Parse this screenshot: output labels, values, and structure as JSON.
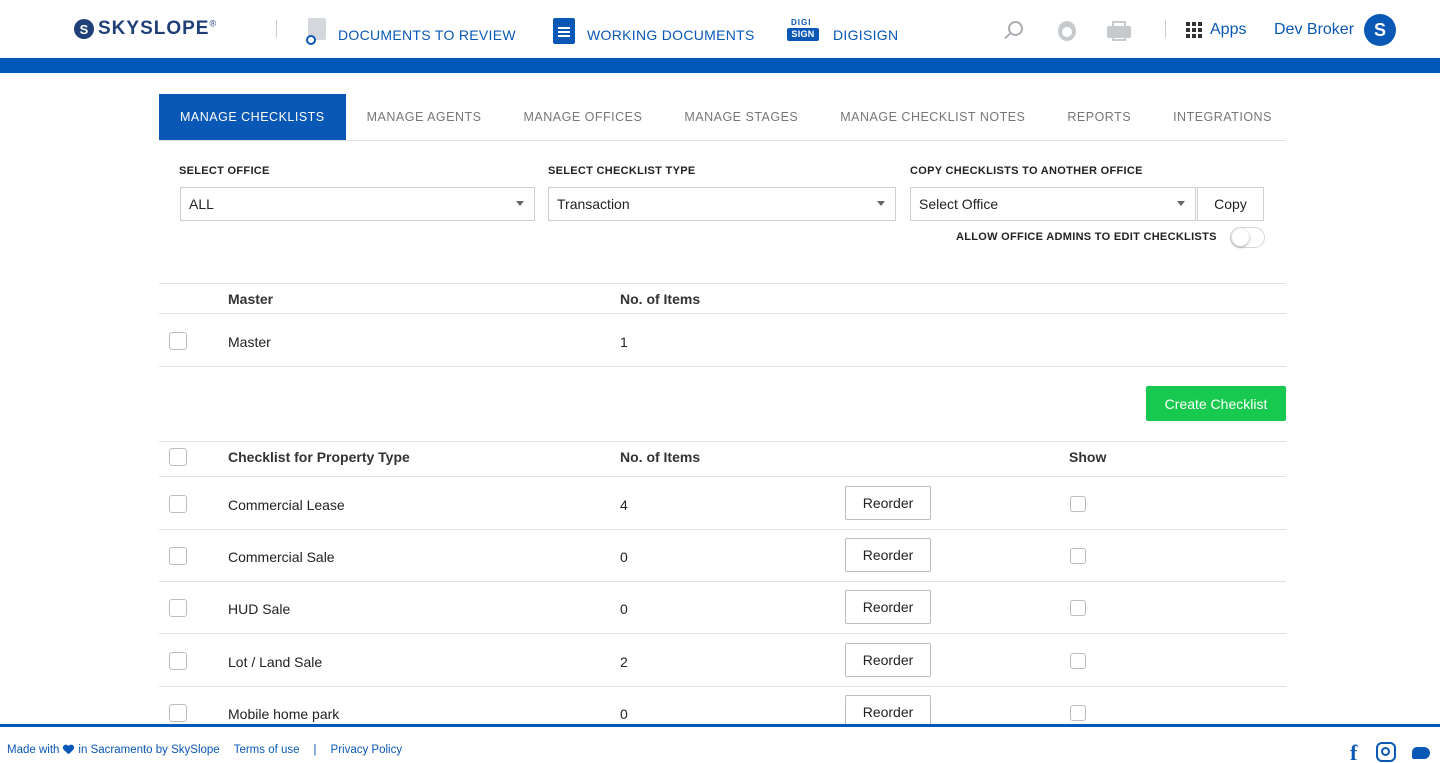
{
  "header": {
    "logo_text": "SKYSLOPE",
    "logo_mark": "S",
    "logo_reg": "®",
    "nav": [
      {
        "label": "DOCUMENTS TO REVIEW",
        "icon": "documents-review-icon"
      },
      {
        "label": "WORKING DOCUMENTS",
        "icon": "working-documents-icon"
      },
      {
        "label": "DIGISIGN",
        "icon": "digisign-icon",
        "badge_top": "DIGI",
        "badge_bottom": "SIGN"
      }
    ],
    "icons": [
      "search-icon",
      "agent-icon",
      "printer-icon"
    ],
    "apps_label": "Apps",
    "user_name": "Dev Broker",
    "avatar_letter": "S"
  },
  "colors": {
    "brand_blue": "#0057b8",
    "link_blue": "#0a58b5",
    "green": "#17c94f"
  },
  "tabs": [
    {
      "label": "MANAGE CHECKLISTS",
      "active": true
    },
    {
      "label": "MANAGE AGENTS",
      "active": false
    },
    {
      "label": "MANAGE OFFICES",
      "active": false
    },
    {
      "label": "MANAGE STAGES",
      "active": false
    },
    {
      "label": "MANAGE CHECKLIST NOTES",
      "active": false
    },
    {
      "label": "REPORTS",
      "active": false
    },
    {
      "label": "INTEGRATIONS",
      "active": false
    }
  ],
  "filters": {
    "office_label": "SELECT OFFICE",
    "office_value": "ALL",
    "type_label": "SELECT CHECKLIST TYPE",
    "type_value": "Transaction",
    "copy_label": "COPY CHECKLISTS TO ANOTHER OFFICE",
    "copy_value": "Select Office",
    "copy_button": "Copy",
    "toggle_label": "ALLOW OFFICE ADMINS TO EDIT CHECKLISTS",
    "toggle_on": false
  },
  "master_table": {
    "headers": {
      "name": "Master",
      "count": "No. of Items"
    },
    "rows": [
      {
        "name": "Master",
        "count": "1"
      }
    ]
  },
  "create_button": "Create Checklist",
  "property_table": {
    "headers": {
      "name": "Checklist for Property Type",
      "count": "No. of Items",
      "show": "Show"
    },
    "reorder_label": "Reorder",
    "rows": [
      {
        "name": "Commercial Lease",
        "count": "4"
      },
      {
        "name": "Commercial Sale",
        "count": "0"
      },
      {
        "name": "HUD Sale",
        "count": "0"
      },
      {
        "name": "Lot / Land Sale",
        "count": "2"
      },
      {
        "name": "Mobile home park",
        "count": "0"
      }
    ]
  },
  "footer": {
    "made_with": "Made with",
    "in_text": "in Sacramento by SkySlope",
    "terms": "Terms of use",
    "separator": "|",
    "privacy": "Privacy Policy",
    "fb_glyph": "f",
    "social": [
      "facebook-icon",
      "instagram-icon",
      "twitter-icon"
    ]
  }
}
